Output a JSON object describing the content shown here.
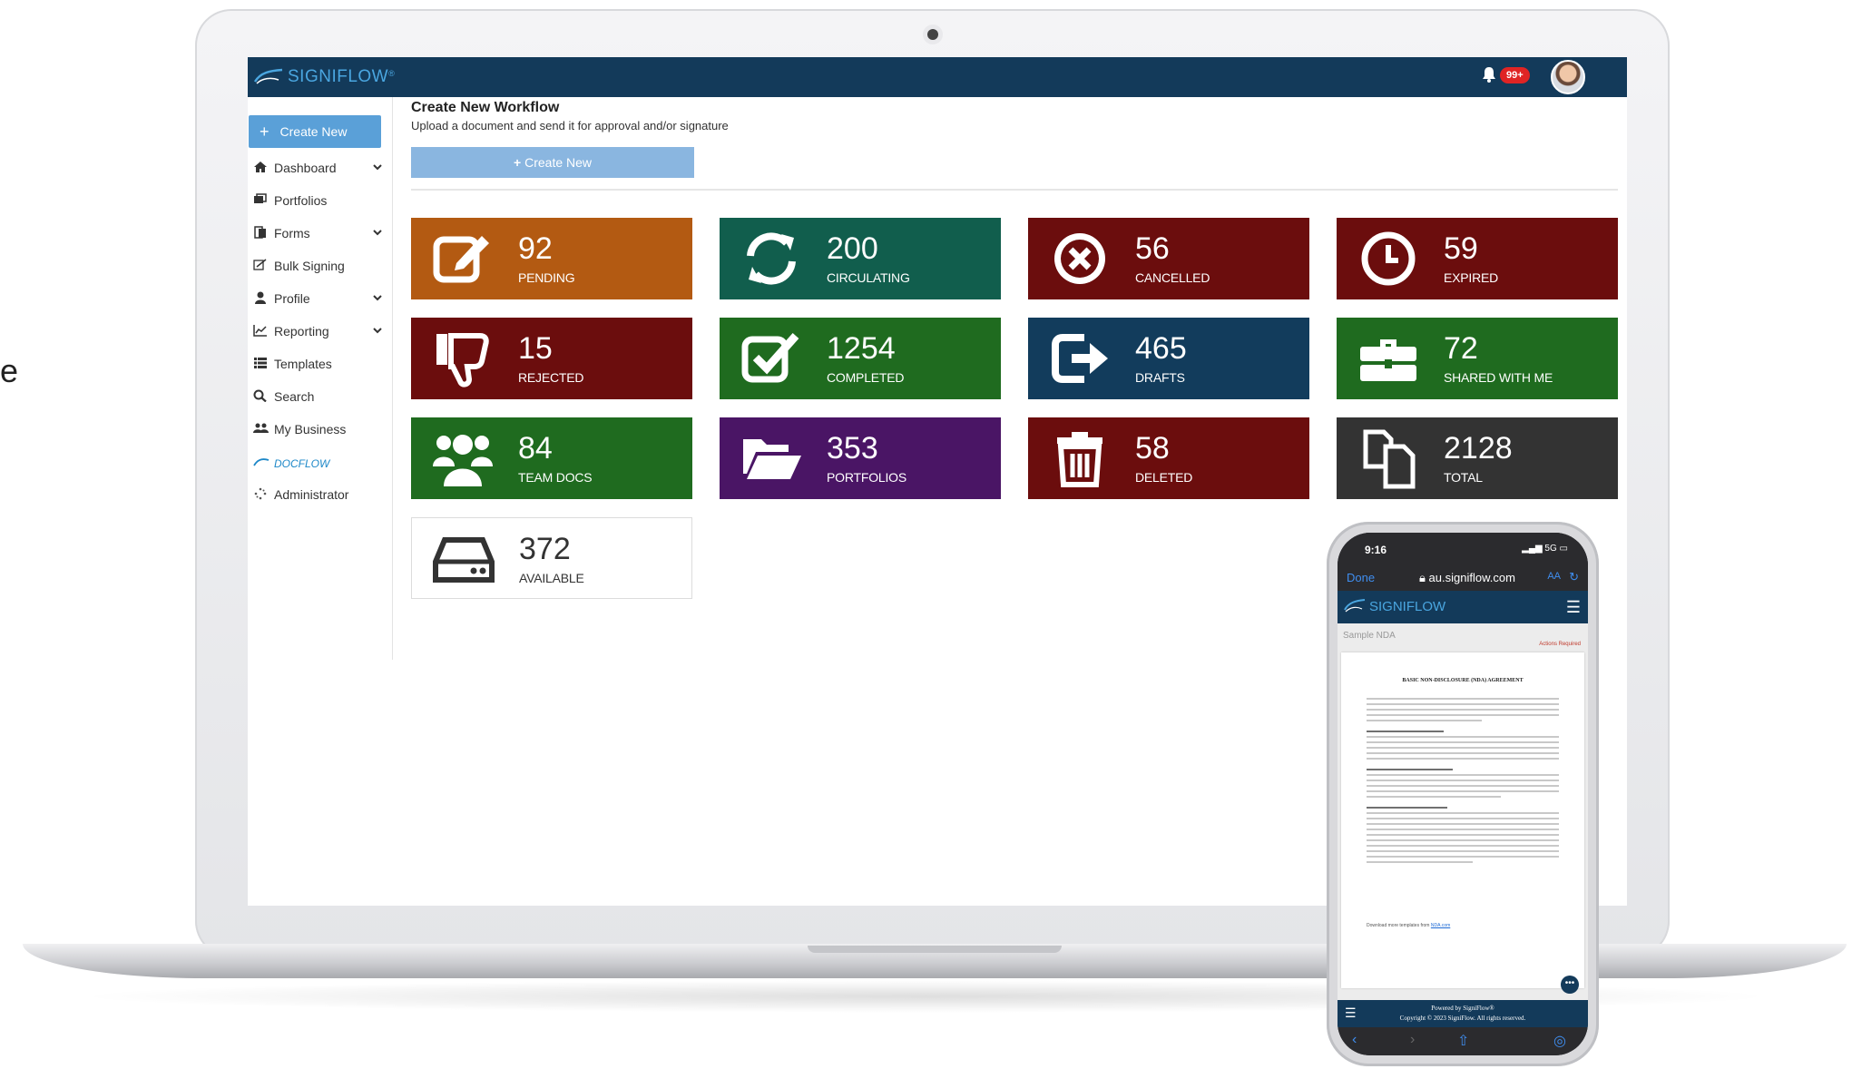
{
  "app": {
    "logo_text": "SIGNIFLOW",
    "logo_mark": "®",
    "notification_badge": "99+",
    "stray_char": "e"
  },
  "sidebar": {
    "create_label": "Create New",
    "items": [
      {
        "label": "Dashboard",
        "icon": "home-icon",
        "has_chevron": true
      },
      {
        "label": "Portfolios",
        "icon": "portfolio-icon",
        "has_chevron": false
      },
      {
        "label": "Forms",
        "icon": "forms-icon",
        "has_chevron": true
      },
      {
        "label": "Bulk Signing",
        "icon": "bulk-sign-icon",
        "has_chevron": false
      },
      {
        "label": "Profile",
        "icon": "user-icon",
        "has_chevron": true
      },
      {
        "label": "Reporting",
        "icon": "chart-icon",
        "has_chevron": true
      },
      {
        "label": "Templates",
        "icon": "list-icon",
        "has_chevron": false
      },
      {
        "label": "Search",
        "icon": "search-icon",
        "has_chevron": false
      },
      {
        "label": "My Business",
        "icon": "users-icon",
        "has_chevron": false
      },
      {
        "label": "DOCFLOW",
        "icon": "docflow-logo",
        "has_chevron": false
      },
      {
        "label": "Administrator",
        "icon": "spinner-icon",
        "has_chevron": false
      }
    ]
  },
  "main": {
    "title": "Create New Workflow",
    "subtitle": "Upload a document and send it for approval and/or signature",
    "create_label": "Create New",
    "tiles": [
      {
        "count": "92",
        "label": "PENDING",
        "icon": "edit-icon",
        "color": "#b35a12"
      },
      {
        "count": "200",
        "label": "CIRCULATING",
        "icon": "refresh-icon",
        "color": "#115e4d"
      },
      {
        "count": "56",
        "label": "CANCELLED",
        "icon": "cancel-icon",
        "color": "#6b0d0d"
      },
      {
        "count": "59",
        "label": "EXPIRED",
        "icon": "clock-icon",
        "color": "#6b0d0d"
      },
      {
        "count": "15",
        "label": "REJECTED",
        "icon": "thumbs-down-icon",
        "color": "#6b0d0d"
      },
      {
        "count": "1254",
        "label": "COMPLETED",
        "icon": "check-square-icon",
        "color": "#1f6b1f"
      },
      {
        "count": "465",
        "label": "DRAFTS",
        "icon": "share-out-icon",
        "color": "#123c5c"
      },
      {
        "count": "72",
        "label": "SHARED WITH ME",
        "icon": "briefcase-icon",
        "color": "#1f6b1f"
      },
      {
        "count": "84",
        "label": "TEAM DOCS",
        "icon": "team-icon",
        "color": "#1f6b1f"
      },
      {
        "count": "353",
        "label": "PORTFOLIOS",
        "icon": "folder-open-icon",
        "color": "#4a1565"
      },
      {
        "count": "58",
        "label": "DELETED",
        "icon": "trash-icon",
        "color": "#6b0d0d"
      },
      {
        "count": "2128",
        "label": "TOTAL",
        "icon": "copy-icon",
        "color": "#333333"
      },
      {
        "count": "372",
        "label": "AVAILABLE",
        "icon": "hard-drive-icon",
        "color": "#ffffff"
      }
    ]
  },
  "phone": {
    "time": "9:16",
    "signal": "5G",
    "done_label": "Done",
    "url": "au.signiflow.com",
    "aa_label": "AA",
    "logo_text": "SIGNIFLOW",
    "doc_title": "Sample NDA",
    "action_required": "Actions Required",
    "doc_heading": "BASIC NON-DISCLOSURE (NDA) AGREEMENT",
    "download_note": "Download more templates from",
    "download_link": "NDA.com",
    "footer_line1": "Powered by SigniFlow®",
    "footer_line2": "Copyright © 2023 SigniFlow. All rights reserved."
  }
}
